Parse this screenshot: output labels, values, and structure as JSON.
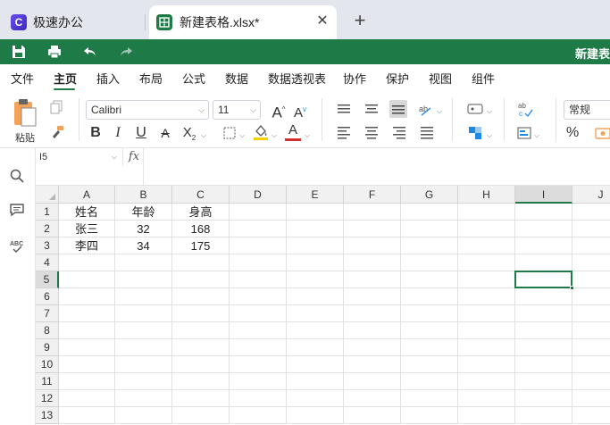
{
  "tabs": [
    {
      "label": "极速办公",
      "icon": "app-logo-icon"
    },
    {
      "label": "新建表格.xlsx*",
      "icon": "spreadsheet-icon"
    }
  ],
  "app_logo_letter": "C",
  "doc_title": "新建表",
  "menu": [
    "文件",
    "主页",
    "插入",
    "布局",
    "公式",
    "数据",
    "数据透视表",
    "协作",
    "保护",
    "视图",
    "组件"
  ],
  "active_menu": "主页",
  "ribbon": {
    "paste_label": "粘贴",
    "font_name": "Calibri",
    "font_size": "11",
    "number_format": "常规",
    "bold": "B",
    "italic": "I",
    "underline": "U",
    "percent": "%"
  },
  "formula_bar": {
    "cell_ref": "I5",
    "fx": "fx",
    "content": ""
  },
  "sheet": {
    "columns": [
      "A",
      "B",
      "C",
      "D",
      "E",
      "F",
      "G",
      "H",
      "I",
      "J"
    ],
    "selected_column": "I",
    "rows": [
      "1",
      "2",
      "3",
      "4",
      "5",
      "6",
      "7",
      "8",
      "9",
      "10",
      "11",
      "12",
      "13"
    ],
    "selected_row": "5",
    "data": [
      [
        "姓名",
        "年龄",
        "身高"
      ],
      [
        "张三",
        "32",
        "168"
      ],
      [
        "李四",
        "34",
        "175"
      ]
    ],
    "active_cell": "I5"
  },
  "colors": {
    "accent": "#1e7a46",
    "tabbar_bg": "#e3e6ec",
    "header_bg": "#f1f1f1",
    "font_color_bar": "#d32f2f",
    "fill_color_bar": "#f5d000"
  }
}
